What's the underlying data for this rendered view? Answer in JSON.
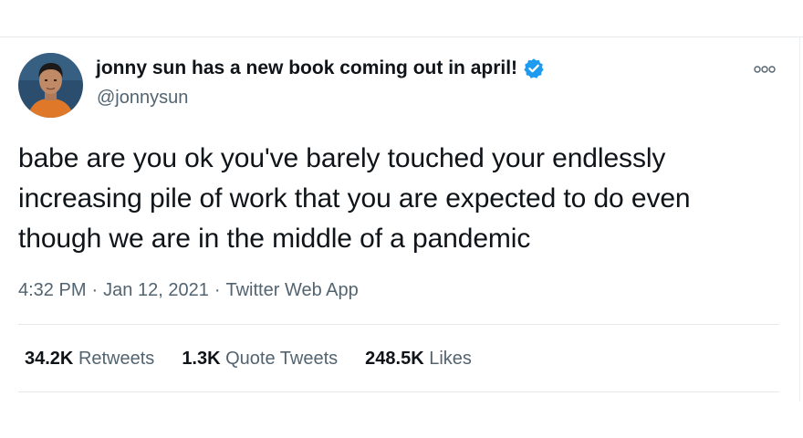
{
  "tweet": {
    "display_name": "jonny sun has a new book coming out in april!",
    "handle": "@jonnysun",
    "text": "babe are you ok you've barely touched your endlessly\nincreasing pile of work that you are expected to do even\nthough we are in the middle of a pandemic",
    "time": "4:32 PM",
    "date": "Jan 12, 2021",
    "source": "Twitter Web App",
    "separator": "·",
    "stats": [
      {
        "count": "34.2K",
        "label": "Retweets"
      },
      {
        "count": "1.3K",
        "label": "Quote Tweets"
      },
      {
        "count": "248.5K",
        "label": "Likes"
      }
    ]
  },
  "icons": {
    "verified": "verified-badge-icon",
    "more": "more-options-icon",
    "avatar": "profile-avatar"
  },
  "colors": {
    "verified_blue": "#1d9bf0",
    "text_primary": "#0f1419",
    "text_secondary": "#536471",
    "divider": "#e6e9eb",
    "avatar_background": "#2b4e6e"
  }
}
